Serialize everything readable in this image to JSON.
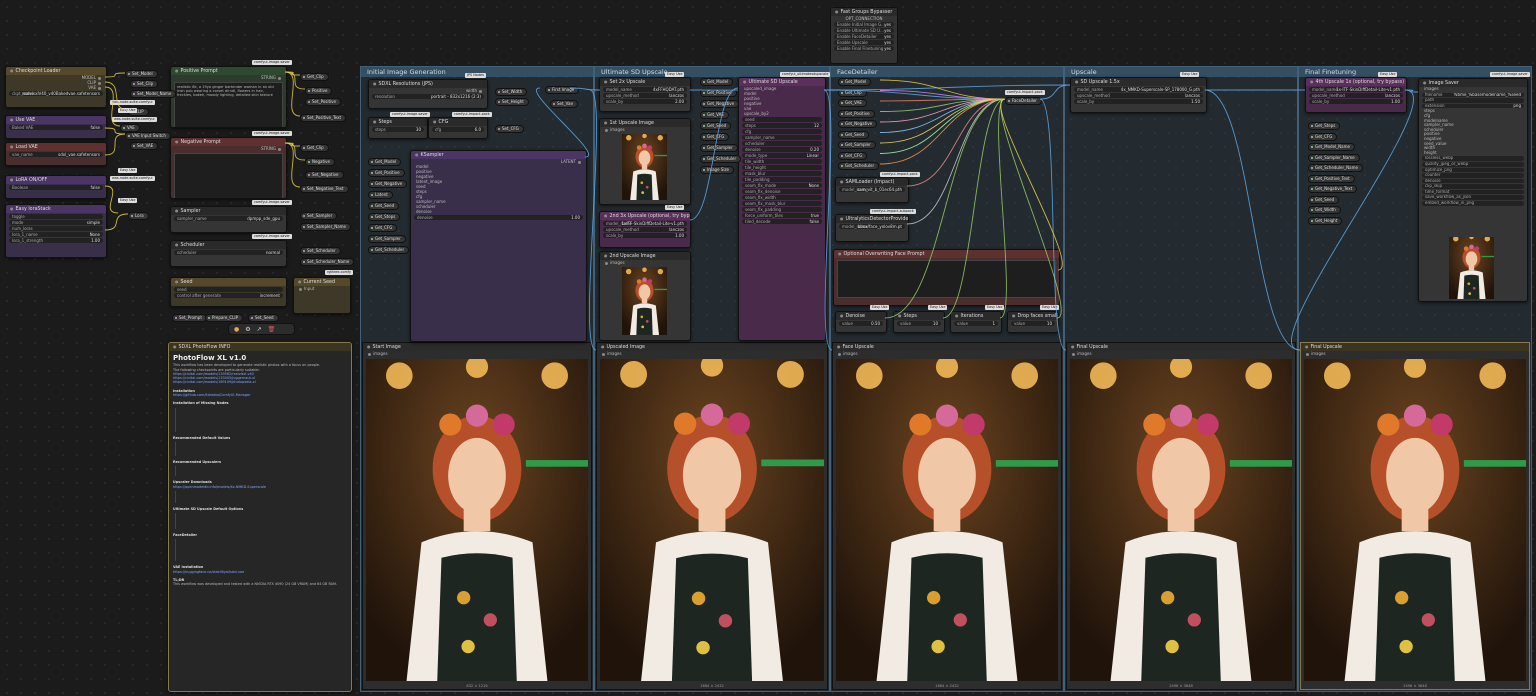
{
  "groups": [
    {
      "title": "Initial Image Generation"
    },
    {
      "title": "Ultimate SD Upscale"
    },
    {
      "title": "FaceDetailer"
    },
    {
      "title": "Upscale"
    },
    {
      "title": "Final Finetuning"
    }
  ],
  "left_nodes": {
    "checkpoint": {
      "title": "Checkpoint Loader",
      "ckpt_name": "ckpt_name",
      "ckpt_value": "realvisxlV40_v40Bakedvae.safetensors",
      "out_model": "MODEL",
      "out_clip": "CLIP",
      "out_vae": "VAE"
    },
    "vae": {
      "title": "Use VAE",
      "label": "Baked VAE",
      "value": "false"
    },
    "load_vae": {
      "title": "Load VAE",
      "label": "vae_name",
      "value": "sdxl_vae.safetensors"
    },
    "lora_onoff": {
      "title": "LoRA ON/OFF",
      "label": "Boolean",
      "value": "false"
    },
    "lora_stack": {
      "title": "Easy loraStack",
      "toggle": "toggle",
      "mode": "simple",
      "num_loras": "num_loras",
      "lora1": "lora_1_name",
      "lora1_val": "None",
      "strength": "lora_1_strength",
      "strength_val": "1.00"
    }
  },
  "pipe_labels": {
    "easy_use": "Easy Use",
    "was_suite": "was-node-suite-comfyui",
    "rgthree": "rgthree-comfy",
    "comfyui_image_saver": "comfyui-image-saver",
    "comfyui_impact_pack": "comfyui-impact-pack",
    "jps": "JPS Nodes",
    "ultimate": "comfyui_ultimatesdupscale",
    "impact_subpack": "comfyui-impact-subpack"
  },
  "set_nodes": [
    "Set_Model",
    "Set_Clip",
    "Set_Model_Name",
    "CLIP",
    "VAE",
    "VAE Input Switch",
    "Set_VAE",
    "Lora"
  ],
  "prompt": {
    "positive_title": "Positive Prompt",
    "positive_text": "realistic 8k, a 19yo ginger bartender woman in an old irish pub wearing a corset dirndl, flowers in hair, freckles, bokeh, moody lighting, detailed skin texture",
    "positive_out": "STRING",
    "negative_title": "Negative Prompt",
    "negative_out": "STRING"
  },
  "get_positive": [
    "Get_Clip",
    "Positive",
    "Set_Positive",
    "Set_Positive_Text"
  ],
  "get_negative": [
    "Get_Clip",
    "Negative",
    "Set_Negative",
    "Set_Negative_Text"
  ],
  "sampler": {
    "title": "Sampler",
    "label": "sampler_name",
    "value": "dpmpp_sde_gpu",
    "set": [
      "Set_Sampler",
      "Set_Sampler_Name"
    ]
  },
  "scheduler": {
    "title": "Scheduler",
    "label": "scheduler",
    "value": "normal",
    "set": [
      "Set_Scheduler",
      "Set_Scheduler_Name"
    ]
  },
  "seed": {
    "title": "Seed",
    "label": "seed",
    "value": "",
    "control": "control after generate",
    "control_val": "increment"
  },
  "current_seed": {
    "title": "Current Seed",
    "label": "Input"
  },
  "toolbar": [
    "⚙",
    "↗",
    "🗑"
  ],
  "set_bottom": [
    "Set_Prompt",
    "Prepare_CLIP",
    "Set_Seed"
  ],
  "info": {
    "title": "SDXL PhotoFlow INFO",
    "heading": "PhotoFlow XL v1.0",
    "intro": "This workflow has been developed to generate realistic photos with a focus on people.",
    "intro2": "The following checkpoints are particularly suitable:",
    "sections": [
      "Installation",
      "Installation of Missing Nodes",
      "Recommended Default Values",
      "Recommended Upscalers",
      "Upscaler Downloads",
      "Ultimate SD Upscale Default Options",
      "FaceDetailer",
      "VAE Installation",
      "TL;DR"
    ],
    "links": [
      "https://civitai.com/models/139562/realvisxl-v40",
      "https://civitai.com/models/133005/juggernaut-xl",
      "https://civitai.com/models/189109/photopedia-xl",
      "https://github.com/ltdrdata/ComfyUI-Manager",
      "https://openmodeldb.info/models/4x-NMKD-Superscale",
      "https://huggingface.co/stabilityai/sdxl-vae"
    ],
    "footer": "This workflow was developed and tested with a NVIDIA RTX 4090 (24 GB VRAM) and 64 GB RAM."
  },
  "ultimate": {
    "set_upscale": "Set 2x Upscale",
    "upscale_model": "4xFFHQDAT.pth",
    "upscale_method": "lanczos",
    "scale_by": "2.00",
    "first_upscale_img": "1st Upscale Image",
    "optional_2nd": "2nd 3x Upscale (optional, try bypass)",
    "second_model": "1xITF-SkinDiffDetail-Lite-v1.pth",
    "second_upscale_img": "2nd Upscale Image",
    "usd_title": "Ultimate SD Upscale",
    "usd_params": [
      "upscaled_image",
      "model",
      "positive",
      "negative",
      "vae",
      "upscale_by",
      "seed",
      "steps",
      "cfg",
      "sampler_name",
      "scheduler",
      "denoise",
      "mode_type",
      "tile_width",
      "tile_height",
      "mask_blur",
      "tile_padding",
      "seam_fix_mode",
      "seam_fix_denoise",
      "seam_fix_width",
      "seam_fix_mask_blur",
      "seam_fix_padding",
      "force_uniform_tiles",
      "tiled_decode"
    ],
    "usd_values": {
      "upscale_by": "2",
      "steps": "12",
      "denoise": "0.20",
      "mode_type": "Linear",
      "seam_fix_mode": "None",
      "force_uniform_tiles": "true",
      "tiled_decode": "false"
    },
    "get_nodes": [
      "Get_Model",
      "Get_Positive",
      "Get_Negative",
      "Get_VAE",
      "Get_Seed",
      "Get_CFG",
      "Get_Sampler",
      "Get_Scheduler",
      "Image Size"
    ]
  },
  "initial": {
    "res_title": "SDXL Resolutions (JPS)",
    "res_label": "resolution",
    "res_value": "portrait - 832x1216 (2:3)",
    "width_out": "Set_Width",
    "height_out": "Set_Height",
    "steps": "Steps",
    "steps_val": "30",
    "cfg": "CFG",
    "cfg_val": "6.0",
    "ksampler": "KSampler",
    "ks_inputs": [
      "model",
      "positive",
      "negative",
      "latent_image",
      "seed",
      "steps",
      "cfg",
      "sampler_name",
      "scheduler",
      "denoise"
    ],
    "ks_denoise": "1.00",
    "ks_out": "LATENT",
    "gets": [
      "Get_Model",
      "Get_Positive",
      "Get_Negative",
      "Latent",
      "Get_Seed",
      "Get_Steps",
      "Get_CFG",
      "Get_Sampler",
      "Get_Scheduler"
    ],
    "first_image": "First Image",
    "set_cfg": "Set_CFG",
    "set_vae": "Set_Vae"
  },
  "face": {
    "get_nodes": [
      "Get_Model",
      "Get_Clip",
      "Get_VAE",
      "Get_Positive",
      "Get_Negative",
      "Get_Seed",
      "Get_Sampler",
      "Get_CFG",
      "Get_Scheduler"
    ],
    "facedetailer": "FaceDetailer",
    "sam_title": "SAMLoader (Impact)",
    "sam_model": "sam_vit_b_01ec64.pth",
    "ultra_title": "UltralyticsDetectorProvider",
    "ultra_model": "bbox/face_yolov8m.pt",
    "face_prompt_title": "Optional Overwriting Face Prompt",
    "denoise": "Denoise",
    "denoise_val": "0.50",
    "steps": "Steps",
    "steps_val": "10",
    "iterations": "Iterations",
    "iter_val": "1",
    "drop": "Drop faces smaller X px",
    "drop_val": "10"
  },
  "upscale": {
    "title": "SD Upscale 1.5x",
    "model": "4x_NMKD-Superscale-SP_178000_G.pth",
    "method": "lanczos",
    "scale": "1.50"
  },
  "finetune": {
    "title": "4th Upscale 1x (optional, try bypass)",
    "model": "1x-ITF-SkinDiffDetail-Lite-v1.pth",
    "image_saver": "Image Saver",
    "saver_fields": [
      "images",
      "filename",
      "path",
      "extension",
      "steps",
      "cfg",
      "modelname",
      "sampler_name",
      "scheduler",
      "positive",
      "negative",
      "seed_value",
      "width",
      "height",
      "lossless_webp",
      "quality_jpeg_or_webp",
      "optimize_png",
      "counter",
      "denoise",
      "clip_skip",
      "time_format",
      "save_workflow_as_json",
      "embed_workflow_in_png"
    ],
    "filename_val": "%time_%basemodelname_%seed",
    "extension_val": "png",
    "gets": [
      "Get_Steps",
      "Get_CFG",
      "Get_Model_Name",
      "Get_Sampler_Name",
      "Get_Scheduler_Name",
      "Get_Positive_Text",
      "Get_Negative_Text",
      "Get_Seed",
      "Get_Width",
      "Get_Height"
    ]
  },
  "previews": [
    {
      "title": "Start Image",
      "caption": "832 × 1216"
    },
    {
      "title": "Upscaled Image",
      "caption": "1664 × 2432"
    },
    {
      "title": "Face Upscale",
      "caption": "1664 × 2432"
    },
    {
      "title": "Final Upscale",
      "caption": "2496 × 3648"
    },
    {
      "title": "Final Upscale",
      "caption": "2496 × 3648"
    }
  ],
  "connections": {
    "title": "Fast Groups Bypasser",
    "label": "OPT_CONNECTION",
    "items": [
      "Enable Initial Image G...",
      "Enable Ultimate SD U...",
      "Enable FaceDetailer",
      "Enable Upscale",
      "Enable Final Finetuning"
    ],
    "state": "yes"
  },
  "colors": {
    "group": "#41607a",
    "gold": "#8a7a45",
    "wire_yellow": "#e8d14a",
    "wire_blue": "#5fa8e8",
    "wire_green": "#9c6"
  }
}
